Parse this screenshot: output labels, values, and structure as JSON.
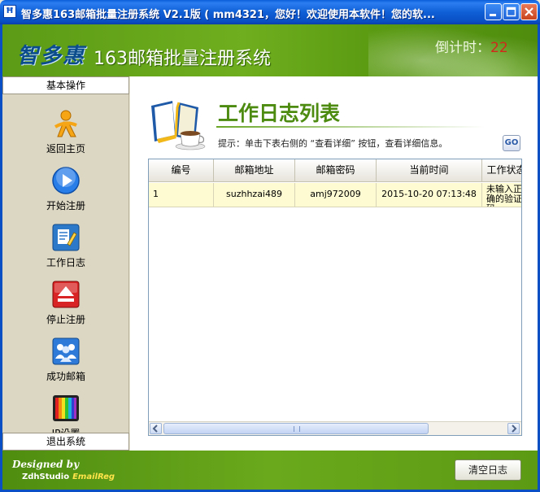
{
  "window": {
    "title": "智多惠163邮箱批量注册系统 V2.1版 ( mm4321，您好！欢迎使用本软件！您的软..."
  },
  "header": {
    "logo_text": "智多惠",
    "app_title": "163邮箱批量注册系统",
    "countdown_label": "倒计时：",
    "countdown_value": "22"
  },
  "sidebar": {
    "section_top": "基本操作",
    "section_bottom": "退出系统",
    "items": [
      {
        "label": "返回主页",
        "icon": "home-figure-icon"
      },
      {
        "label": "开始注册",
        "icon": "play-icon"
      },
      {
        "label": "工作日志",
        "icon": "log-icon"
      },
      {
        "label": "停止注册",
        "icon": "eject-icon"
      },
      {
        "label": "成功邮箱",
        "icon": "users-icon"
      },
      {
        "label": "IP设置",
        "icon": "color-bars-icon"
      }
    ]
  },
  "main": {
    "title": "工作日志列表",
    "hint": "提示：单击下表右侧的 “查看详细” 按钮，查看详细信息。",
    "go_label": "GO",
    "columns": [
      "编号",
      "邮箱地址",
      "邮箱密码",
      "当前时间",
      "工作状态"
    ],
    "rows": [
      {
        "id": "1",
        "email": "suzhhzai489",
        "password": "amj972009",
        "time": "2015-10-20 07:13:48",
        "status": "未输入正确的验证码。"
      }
    ],
    "scroll_grip": "III"
  },
  "footer": {
    "designed_by": "Designed by",
    "studio": "ZdhStudio",
    "brand": "EmailReg",
    "clear_button": "清空日志"
  },
  "colors": {
    "green_header": "#6fae1e",
    "title_green": "#4c8a10",
    "row_highlight": "#fefbd2",
    "titlebar_blue": "#0a5ed8",
    "countdown_red": "#d2281c"
  }
}
